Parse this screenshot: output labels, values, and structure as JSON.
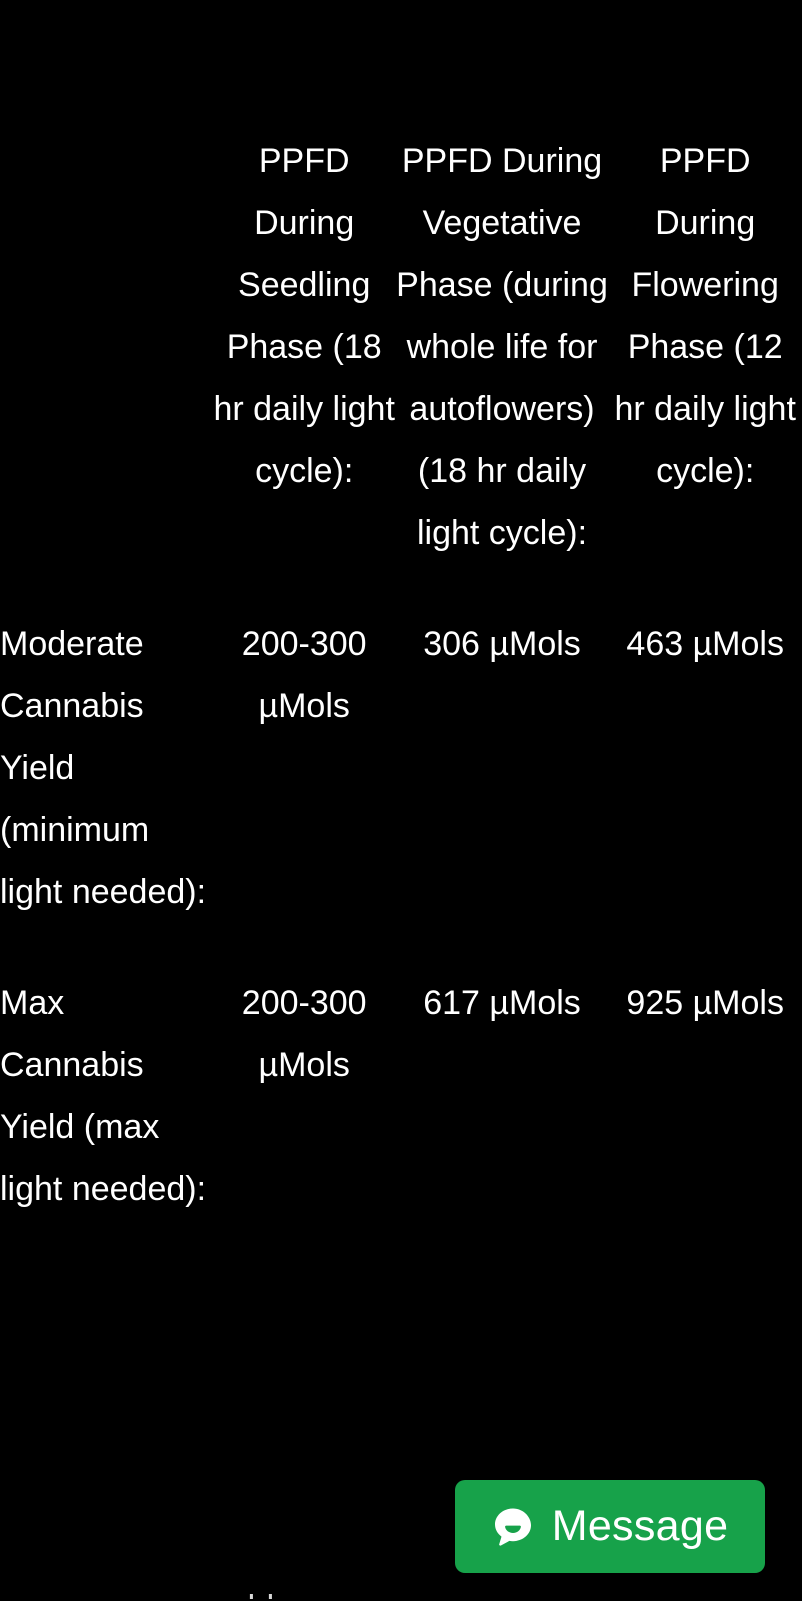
{
  "page": {
    "background_color": "#000000",
    "text_color": "#ffffff"
  },
  "table": {
    "name": "ppfd-requirements-table",
    "headers": [
      "",
      "PPFD During Seedling Phase (18 hr daily light cycle):",
      "PPFD During Vegetative Phase (during whole life for autoflowers) (18 hr daily light cycle):",
      "PPFD During Flowering Phase (12 hr daily light cycle):"
    ],
    "rows": [
      {
        "label": "Moderate Cannabis Yield (minimum light needed):",
        "seedling": "200-300 µMols",
        "vegetative": "306 µMols",
        "flowering": "463 µMols"
      },
      {
        "label": "Max Cannabis Yield (max light needed):",
        "seedling": "200-300 µMols",
        "vegetative": "617 µMols",
        "flowering": "925 µMols"
      }
    ]
  },
  "message_button": {
    "label": "Message",
    "icon": "speech-bubble-icon",
    "background_color": "#17a24a",
    "text_color": "#ffffff"
  },
  "bottom_clipped_text": "Above will be approximate"
}
